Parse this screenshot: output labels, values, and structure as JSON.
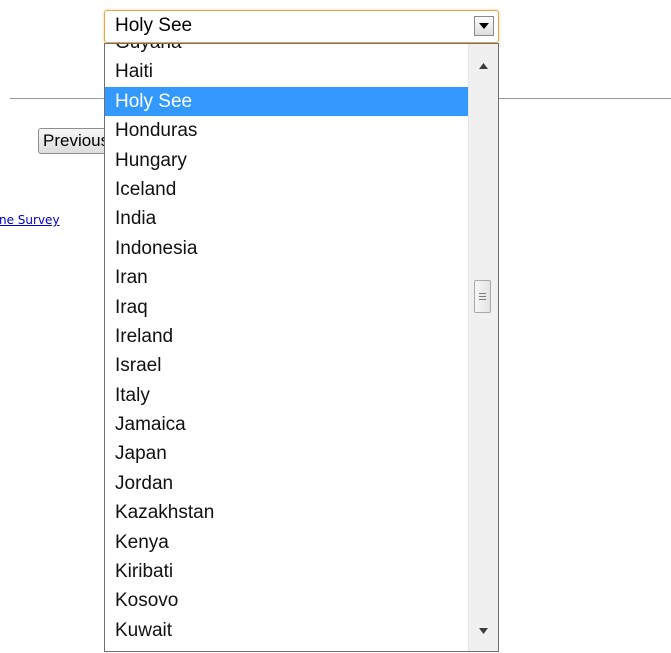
{
  "select": {
    "selected_value": "Holy See"
  },
  "dropdown": {
    "options": [
      "Guyana",
      "Haiti",
      "Holy See",
      "Honduras",
      "Hungary",
      "Iceland",
      "India",
      "Indonesia",
      "Iran",
      "Iraq",
      "Ireland",
      "Israel",
      "Italy",
      "Jamaica",
      "Japan",
      "Jordan",
      "Kazakhstan",
      "Kenya",
      "Kiribati",
      "Kosovo",
      "Kuwait"
    ],
    "selected_index": 2
  },
  "page": {
    "previous_button_label": "Previous",
    "survey_link_text": "ne Survey"
  },
  "icons": {
    "select_arrow": "chevron-down-icon",
    "scroll_up": "scroll-up-arrow-icon",
    "scroll_down": "scroll-down-arrow-icon",
    "scroll_grip": "grip-lines-icon"
  },
  "colors": {
    "selection_bg": "#3399ff",
    "focus_border": "#e2a64e",
    "link": "#0000cc"
  }
}
